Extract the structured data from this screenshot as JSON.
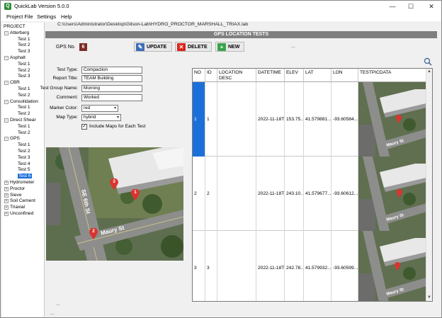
{
  "window": {
    "title": "QuickLab  Version 5.0.0",
    "minimize": "—",
    "maximize": "☐",
    "close": "✕"
  },
  "menu": [
    "Project File",
    "Settings",
    "Help"
  ],
  "tree": {
    "root": "PROJECT",
    "groups": [
      {
        "label": "Atterberg",
        "expanded": true,
        "children": [
          "Test 1",
          "Test 2",
          "Test 3"
        ]
      },
      {
        "label": "Asphalt",
        "expanded": true,
        "children": [
          "Test 1",
          "Test 2",
          "Test 3"
        ]
      },
      {
        "label": "CBR",
        "expanded": true,
        "children": [
          "Test 1",
          "Test 2"
        ]
      },
      {
        "label": "Consolidation",
        "expanded": true,
        "children": [
          "Test 1",
          "Test 2"
        ]
      },
      {
        "label": "Direct Shear",
        "expanded": true,
        "children": [
          "Test 1",
          "Test 2"
        ]
      },
      {
        "label": "GPS",
        "expanded": true,
        "children": [
          "Test 1",
          "Test 2",
          "Test 3",
          "Test 4",
          "Test 5",
          "Test 6"
        ],
        "selected_child": 5
      },
      {
        "label": "Hydrometer",
        "expanded": false,
        "children": []
      },
      {
        "label": "Proctor",
        "expanded": false,
        "children": []
      },
      {
        "label": "Sieve",
        "expanded": false,
        "children": []
      },
      {
        "label": "Soil Cement",
        "expanded": false,
        "children": []
      },
      {
        "label": "Triaxial",
        "expanded": false,
        "children": []
      },
      {
        "label": "Unconfined",
        "expanded": false,
        "children": []
      }
    ]
  },
  "path": "C:\\Users\\Administrator\\Desktop\\Gilson-Lab\\HYDRO_PROCTOR_MARSHALL_TRIAX.lab",
  "section_title": "GPS LOCATION TESTS",
  "gps": {
    "label": "GPS No.",
    "value": "6"
  },
  "toolbar": {
    "update": "UPDATE",
    "delete": "DELETE",
    "new": "NEW",
    "dots": "..."
  },
  "form": {
    "test_type_label": "Test Type:",
    "test_type": "Compaction",
    "report_title_label": "Report Title:",
    "report_title": "TEAM Building",
    "test_group_label": "Test Group Name:",
    "test_group": "Morning",
    "comment_label": "Comment:",
    "comment": "Worked",
    "marker_color_label": "Marker Color:",
    "marker_color": "red",
    "map_type_label": "Map Type:",
    "map_type": "hybrid",
    "include_maps_label": "Include Maps for Each Test",
    "include_maps_checked": true
  },
  "map": {
    "street_1": "SE 6th St",
    "street_2": "Maury St",
    "markers": [
      "1",
      "2",
      "3"
    ],
    "marker_color": "#d9352e"
  },
  "grid": {
    "columns": [
      "NO",
      "ID",
      "LOCATION DESC",
      "DATETIME",
      "ELEV",
      "LAT",
      "LON",
      "TESTPICDATA"
    ],
    "rows": [
      {
        "no": "1",
        "id": "1",
        "desc": "",
        "datetime": "2022-11-18T0",
        "elev": "153.75...",
        "lat": "41.579881...",
        "lon": "-93.60584..."
      },
      {
        "no": "2",
        "id": "2",
        "desc": "",
        "datetime": "2022-11-18T0",
        "elev": "243.10...",
        "lat": "41.579677...",
        "lon": "-93.60612..."
      },
      {
        "no": "3",
        "id": "3",
        "desc": "",
        "datetime": "2022-11-18T0",
        "elev": "242.78...",
        "lat": "41.579932...",
        "lon": "-93.60599..."
      }
    ],
    "thumb_street": "Maury St"
  },
  "bottom": {
    "dots1": "...",
    "dots2": "..."
  },
  "colors": {
    "selection": "#1c6fd8",
    "section_bar": "#7f7f7f",
    "gps_badge": "#7b2d26"
  }
}
